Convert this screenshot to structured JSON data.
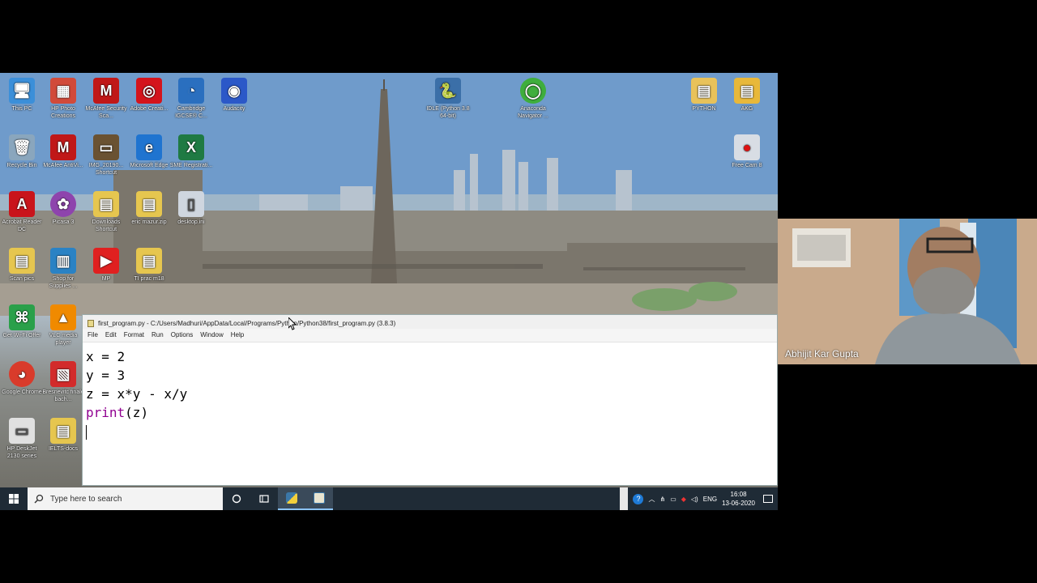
{
  "desktop": {
    "icons": [
      {
        "label": "This PC",
        "glyph": "🖥",
        "color": "#3b8fd9"
      },
      {
        "label": "HP Photo Creations",
        "glyph": "▦",
        "color": "#d14a3a"
      },
      {
        "label": "McAfee Security Sca...",
        "glyph": "M",
        "color": "#c01818"
      },
      {
        "label": "Adobe Creati...",
        "glyph": "◎",
        "color": "#d4141c"
      },
      {
        "label": "Cambridge IGCSE® C...",
        "glyph": "◔",
        "color": "#2a6fbf"
      },
      {
        "label": "Audacity",
        "glyph": "◉",
        "color": "#2b58c8"
      },
      {
        "label": "IDLE (Python 3.8 64-bit)",
        "glyph": "🐍",
        "color": "#3b6fa8"
      },
      {
        "label": "Anaconda Navigator ...",
        "glyph": "◯",
        "color": "#3fae3c"
      },
      {
        "label": "PYTHON",
        "glyph": "▤",
        "color": "#e8c25a"
      },
      {
        "label": "AKG",
        "glyph": "▤",
        "color": "#e8b83a"
      },
      {
        "label": "Recycle Bin",
        "glyph": "🗑",
        "color": "#8aa6bd"
      },
      {
        "label": "McAfee AntiVi...",
        "glyph": "M",
        "color": "#c01818"
      },
      {
        "label": "IMG_20190... Shortcut",
        "glyph": "▭",
        "color": "#6a5232"
      },
      {
        "label": "Microsoft Edge",
        "glyph": "e",
        "color": "#1f74d0"
      },
      {
        "label": "SME Registrati...",
        "glyph": "X",
        "color": "#1f7a43"
      },
      {
        "label": "Free Cam 8",
        "glyph": "●",
        "color": "#d8dde4"
      },
      {
        "label": "Acrobat Reader DC",
        "glyph": "A",
        "color": "#c9141b"
      },
      {
        "label": "Picasa 3",
        "glyph": "✿",
        "color": "#8e44ad"
      },
      {
        "label": "Downloads Shortcut",
        "glyph": "▤",
        "color": "#e6c64f"
      },
      {
        "label": "eric mazur.zip",
        "glyph": "▤",
        "color": "#e6c64f"
      },
      {
        "label": "desktop.ini",
        "glyph": "▯",
        "color": "#cfd6df"
      },
      {
        "label": "Scan pics",
        "glyph": "▤",
        "color": "#e6c64f"
      },
      {
        "label": "Shop for Supplies ...",
        "glyph": "▥",
        "color": "#2a82c4"
      },
      {
        "label": "MP",
        "glyph": "▶",
        "color": "#e02020"
      },
      {
        "label": "TI prac m18",
        "glyph": "▤",
        "color": "#e6c64f"
      },
      {
        "label": "Get Wi-Fi Offer",
        "glyph": "⌘",
        "color": "#2aa04a"
      },
      {
        "label": "VLC media player",
        "glyph": "▲",
        "color": "#f08a00"
      },
      {
        "label": "Google Chrome",
        "glyph": "◕",
        "color": "#d93b2b"
      },
      {
        "label": "Bresnevitc finale bach...",
        "glyph": "▧",
        "color": "#d22b2b"
      },
      {
        "label": "HP DeskJet 2130 series",
        "glyph": "▭",
        "color": "#e0e0e0"
      },
      {
        "label": "IELTS-docs",
        "glyph": "▤",
        "color": "#e6c64f"
      }
    ]
  },
  "idle_window": {
    "title": "first_program.py - C:/Users/Madhuri/AppData/Local/Programs/Python/Python38/first_program.py (3.8.3)",
    "menu": [
      "File",
      "Edit",
      "Format",
      "Run",
      "Options",
      "Window",
      "Help"
    ],
    "code": {
      "line1": "x = 2",
      "line2": "y = 3",
      "line3": "z = x*y - x/y",
      "line4_kw": "print",
      "line4_rest": "(z)"
    }
  },
  "taskbar": {
    "search_placeholder": "Type here to search",
    "language": "ENG",
    "time": "16:08",
    "date": "13-06-2020"
  },
  "webcam": {
    "participant_name": "Abhijit Kar Gupta"
  },
  "colors": {
    "taskbar_bg": "#1f2b36",
    "keyword": "#900090"
  }
}
